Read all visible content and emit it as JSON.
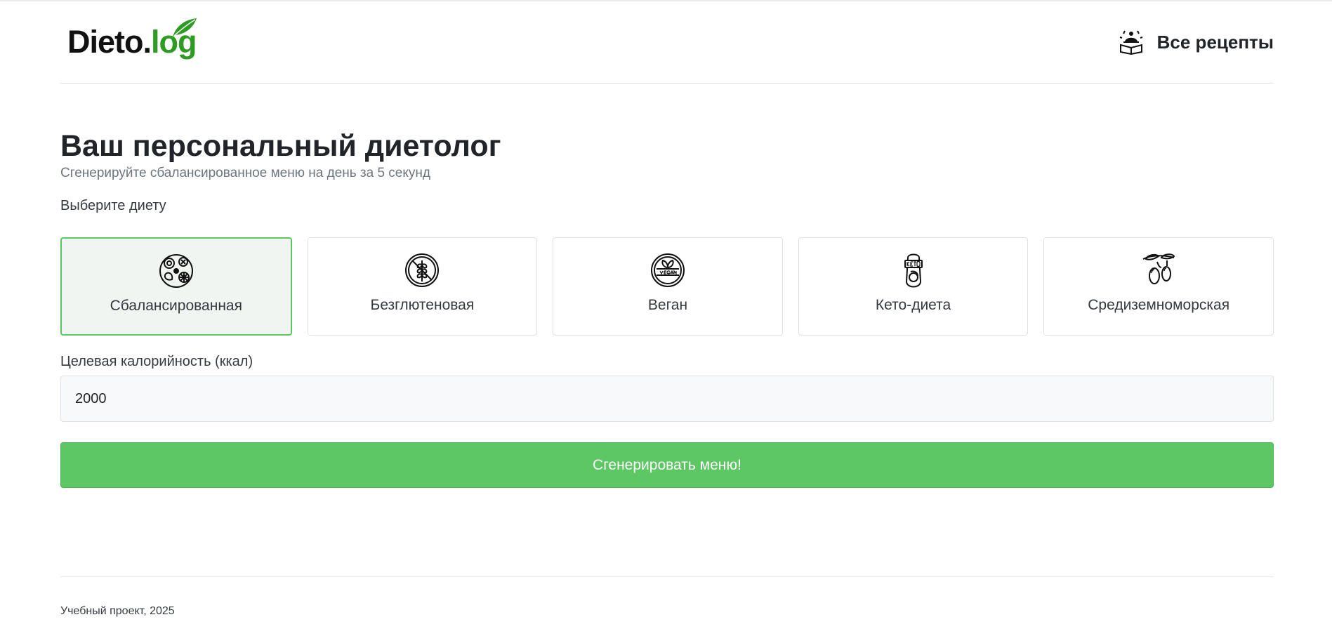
{
  "brand": {
    "part1": "Dieto.",
    "part2": "log"
  },
  "nav": {
    "all_recipes": "Все рецепты"
  },
  "main": {
    "title": "Ваш персональный диетолог",
    "subtitle": "Сгенерируйте сбалансированное меню на день за 5 секунд",
    "diet_label": "Выберите диету",
    "diets": [
      {
        "label": "Сбалансированная",
        "icon": "balanced-plate-icon",
        "selected": true
      },
      {
        "label": "Безглютеновая",
        "icon": "gluten-free-icon",
        "selected": false
      },
      {
        "label": "Веган",
        "icon": "vegan-icon",
        "selected": false
      },
      {
        "label": "Кето-диета",
        "icon": "keto-icon",
        "selected": false
      },
      {
        "label": "Средиземноморская",
        "icon": "olive-icon",
        "selected": false
      }
    ],
    "calories_label": "Целевая калорийность (ккал)",
    "calories_value": "2000",
    "generate_label": "Сгенерировать меню!"
  },
  "footer": {
    "text": "Учебный проект, 2025"
  },
  "colors": {
    "accent": "#5cc763",
    "brand_green": "#2e9b23"
  }
}
